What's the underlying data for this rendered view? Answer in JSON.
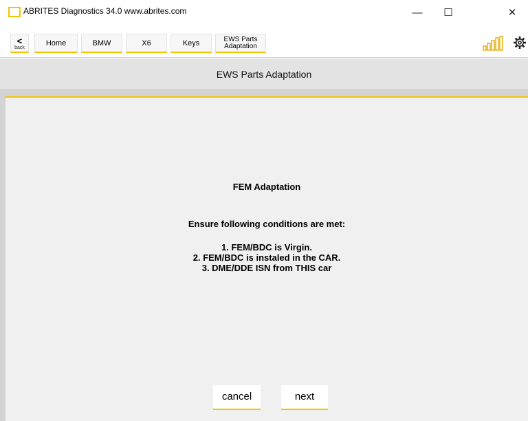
{
  "window": {
    "title": "ABRITES Diagnostics 34.0   www.abrites.com",
    "minimize": "—",
    "maximize": "☐",
    "close": "✕"
  },
  "nav": {
    "back_chevron": "<",
    "back_label": "back",
    "crumbs": [
      "Home",
      "BMW",
      "X6",
      "Keys"
    ],
    "current_line1": "EWS Parts",
    "current_line2": "Adaptation",
    "signal_icon": "signal-bars-icon",
    "settings_icon": "gear-icon"
  },
  "page": {
    "title": "EWS Parts Adaptation"
  },
  "message": {
    "title": "FEM Adaptation",
    "conditions_heading": "Ensure following conditions are met:",
    "lines": [
      "1. FEM/BDC is Virgin.",
      "2. FEM/BDC is instaled in the CAR.",
      "3. DME/DDE ISN from THIS car"
    ]
  },
  "actions": {
    "cancel_label": "cancel",
    "next_label": "next"
  },
  "colors": {
    "accent": "#f5c400",
    "header_bg": "#e3e3e3",
    "panel_bg": "#f0f0f0"
  }
}
